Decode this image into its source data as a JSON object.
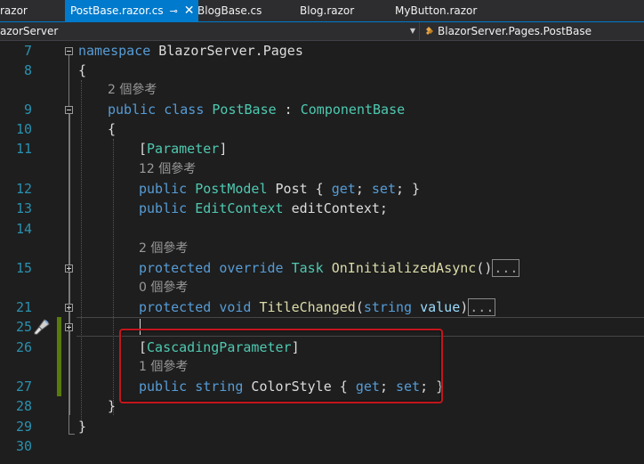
{
  "tabs": {
    "first_partial": "razor",
    "active": "PostBase.razor.cs",
    "items": [
      "BlogBase.cs",
      "Blog.razor",
      "MyButton.razor"
    ]
  },
  "navbar": {
    "project": "azorServer",
    "member": "BlazorServer.Pages.PostBase"
  },
  "line_numbers": [
    "7",
    "8",
    "9",
    "10",
    "11",
    "12",
    "13",
    "14",
    "15",
    "21",
    "25",
    "26",
    "27",
    "28",
    "29",
    "30"
  ],
  "code": {
    "l7_ns_kw": "namespace",
    "l7_ns_name": " BlazorServer.Pages",
    "l8": "{",
    "lens_class": "2 個參考",
    "l9_kw1": "public",
    "l9_kw2": "class",
    "l9_name": "PostBase",
    "l9_colon": " : ",
    "l9_base": "ComponentBase",
    "l10": "{",
    "l11_open": "[",
    "l11_attr": "Parameter",
    "l11_close": "]",
    "lens_post": "12 個參考",
    "l12_kw": "public",
    "l12_type": "PostModel",
    "l12_rest1": " Post { ",
    "l12_get": "get",
    "l12_mid": "; ",
    "l12_set": "set",
    "l12_end": "; }",
    "l13_kw": "public",
    "l13_type": "EditContext",
    "l13_rest": " editContext;",
    "lens_oninit": "2 個參考",
    "l15_kw1": "protected",
    "l15_kw2": "override",
    "l15_type": "Task",
    "l15_method": "OnInitializedAsync",
    "l15_paren": "()",
    "l15_collapsed": "...",
    "lens_title": "0 個參考",
    "l21_kw1": "protected",
    "l21_kw2": "void",
    "l21_method": "TitleChanged",
    "l21_open": "(",
    "l21_ptype": "string",
    "l21_pname": " value",
    "l21_close": ")",
    "l21_collapsed": "...",
    "l26_open": "[",
    "l26_attr": "CascadingParameter",
    "l26_close": "]",
    "lens_color": "1 個參考",
    "l27_kw": "public",
    "l27_type": "string",
    "l27_name": " ColorStyle { ",
    "l27_get": "get",
    "l27_mid": "; ",
    "l27_set": "set",
    "l27_end": "; }",
    "l28": "}",
    "l29": "}"
  },
  "colors": {
    "keyword": "#569cd6",
    "type": "#4ec9b0",
    "method": "#dcdcaa",
    "parameter": "#9cdcfe",
    "line_number": "#2b91af",
    "highlight_box": "#c4161c",
    "active_tab": "#007acc"
  },
  "icons": {
    "pin": "pin-icon",
    "close": "close-icon",
    "class": "class-icon",
    "quick_actions": "paintbrush-icon"
  }
}
